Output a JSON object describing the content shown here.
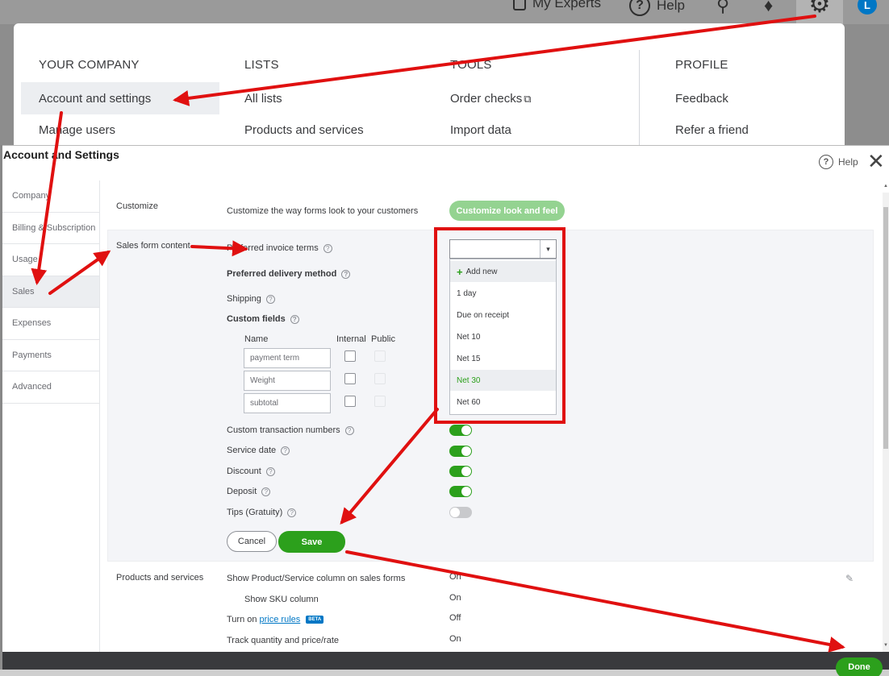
{
  "topbar": {
    "my_experts": "My Experts",
    "help": "Help",
    "help_glyph": "?",
    "search_icon": "search-icon",
    "bell_icon": "bell-icon",
    "gear_icon": "gear-icon",
    "avatar_initial": "L"
  },
  "menu": {
    "columns": [
      {
        "heading": "YOUR COMPANY",
        "items": [
          "Account and settings",
          "Manage users"
        ]
      },
      {
        "heading": "LISTS",
        "items": [
          "All lists",
          "Products and services"
        ]
      },
      {
        "heading": "TOOLS",
        "items": [
          "Order checks",
          "Import data"
        ]
      },
      {
        "heading": "PROFILE",
        "items": [
          "Feedback",
          "Refer a friend"
        ]
      }
    ]
  },
  "dialog": {
    "title": "Account and Settings",
    "help_label": "Help",
    "help_glyph": "?",
    "close_glyph": "✕",
    "nav": [
      "Company",
      "Billing & Subscription",
      "Usage",
      "Sales",
      "Expenses",
      "Payments",
      "Advanced"
    ],
    "active_nav": "Sales"
  },
  "customize": {
    "section": "Customize",
    "description": "Customize the way forms look to your customers",
    "button": "Customize look and feel"
  },
  "sales_form": {
    "section": "Sales form content",
    "preferred_terms": "Preferred invoice terms",
    "preferred_delivery": "Preferred delivery method",
    "shipping": "Shipping",
    "custom_fields": "Custom fields",
    "col_name": "Name",
    "col_internal": "Internal",
    "col_public": "Public",
    "fields": [
      "payment term",
      "Weight",
      "subtotal"
    ],
    "toggles": [
      {
        "label": "Custom transaction numbers",
        "on": true
      },
      {
        "label": "Service date",
        "on": true
      },
      {
        "label": "Discount",
        "on": true
      },
      {
        "label": "Deposit",
        "on": true
      },
      {
        "label": "Tips (Gratuity)",
        "on": false
      }
    ],
    "cancel": "Cancel",
    "save": "Save"
  },
  "terms_dropdown": {
    "arrow_glyph": "▾",
    "add_new": "Add new",
    "options": [
      "1 day",
      "Due on receipt",
      "Net 10",
      "Net 15",
      "Net 30",
      "Net 60"
    ],
    "selected": "Net 30"
  },
  "products": {
    "section": "Products and services",
    "rows": [
      {
        "label": "Show Product/Service column on sales forms",
        "value": "On"
      },
      {
        "label": "Show SKU column",
        "value": "On"
      },
      {
        "label_prefix": "Turn on",
        "link": "price rules",
        "badge": "BETA",
        "value": "Off"
      },
      {
        "label": "Track quantity and price/rate",
        "value": "On"
      }
    ]
  },
  "footer": {
    "done": "Done"
  },
  "colors": {
    "accent_green": "#2ca01c",
    "annotation_red": "#e01010",
    "link_blue": "#0077c5"
  }
}
